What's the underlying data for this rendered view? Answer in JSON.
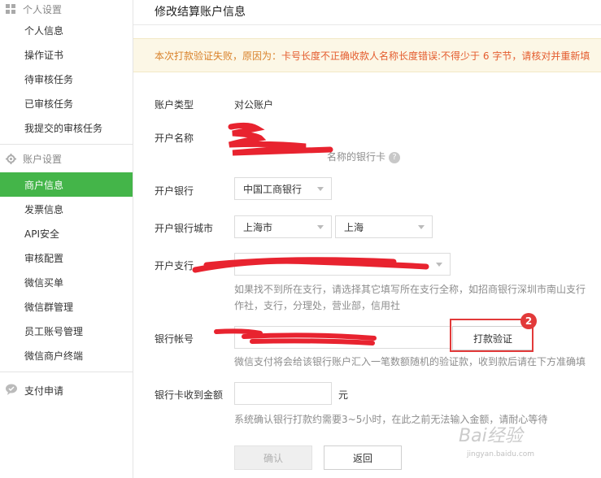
{
  "sidebar": {
    "group_personal": "个人设置",
    "personal_items": [
      "个人信息",
      "操作证书",
      "待审核任务",
      "已审核任务",
      "我提交的审核任务"
    ],
    "group_account": "账户设置",
    "account_items": [
      "商户信息",
      "发票信息",
      "API安全",
      "审核配置",
      "微信买单",
      "微信群管理",
      "员工账号管理",
      "微信商户终端"
    ],
    "active_item": "商户信息",
    "group_pay": "支付申请"
  },
  "main": {
    "title": "修改结算账户信息",
    "alert_prefix": "本次打款验证失败，原因为：",
    "alert_reason": "卡号长度不正确收款人名称长度错误:不得少于 6 字节，请核对并重新填",
    "form": {
      "account_type_label": "账户类型",
      "account_type_value": "对公账户",
      "account_name_label": "开户名称",
      "account_name_help": "名称的银行卡",
      "bank_label": "开户银行",
      "bank_value": "中国工商银行",
      "city_label": "开户银行城市",
      "province_value": "上海市",
      "city_value": "上海",
      "branch_label": "开户支行",
      "branch_help_1": "如果找不到所在支行，请选择其它填写所在支行全称，如招商银行深圳市南山支行",
      "branch_help_2": "作社，支行，分理处，营业部，信用社",
      "account_no_label": "银行帐号",
      "verify_button": "打款验证",
      "step_badge": "2",
      "account_no_help": "微信支付将会给该银行账户汇入一笔数额随机的验证款，收到款后请在下方准确填",
      "amount_label": "银行卡收到金额",
      "amount_unit": "元",
      "amount_help": "系统确认银行打款约需要3~5小时，在此之前无法输入金额，请耐心等待",
      "confirm_button": "确认",
      "back_button": "返回"
    }
  },
  "watermark": {
    "text": "Bai经验",
    "sub": "jingyan.baidu.com"
  }
}
